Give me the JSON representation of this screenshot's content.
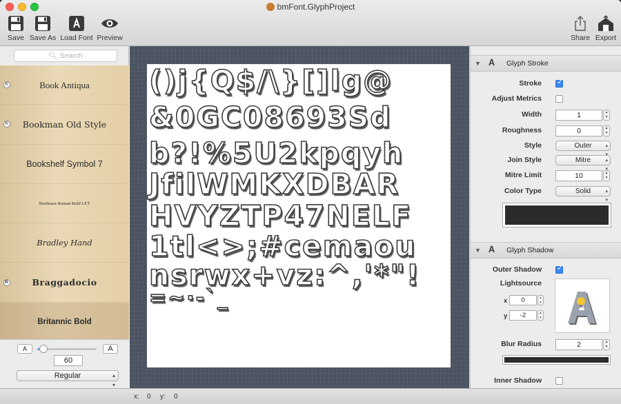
{
  "window": {
    "title": "bmFont.GlyphProject"
  },
  "toolbar": {
    "save": "Save",
    "save_as": "Save As",
    "load_font": "Load Font",
    "preview": "Preview",
    "share": "Share",
    "export": "Export"
  },
  "sidebar": {
    "search_placeholder": "Search",
    "fonts": [
      {
        "name": "Book Antiqua",
        "badge": "K"
      },
      {
        "name": "Bookman Old Style",
        "badge": "K"
      },
      {
        "name": "Bookshelf Symbol 7",
        "badge": ""
      },
      {
        "name": "Bordeaux Roman Bold LET",
        "badge": ""
      },
      {
        "name": "Bradley Hand",
        "badge": ""
      },
      {
        "name": "Braggadocio",
        "badge": "K"
      },
      {
        "name": "Britannic Bold",
        "badge": ""
      }
    ],
    "selected_font": "Britannic Bold",
    "size_small_label": "A",
    "size_large_label": "A",
    "size_value": "60",
    "size_slider_fraction": 0.1,
    "style": "Regular"
  },
  "canvas": {
    "glyph_rows": [
      "()j{Q$/\\}[]lg@",
      "&0GC08693Sd",
      "b?!%5U2kpqyh",
      "JfilWMKXDBAR",
      "HVYZTP47NELF",
      "1tl<>;#cemaou",
      "nsrwx+vz:^,'*\"!",
      "=~·-`_"
    ]
  },
  "inspector": {
    "stroke_section": {
      "title": "Glyph Stroke",
      "stroke_label": "Stroke",
      "stroke_checked": true,
      "adjust_metrics_label": "Adjust Metrics",
      "adjust_metrics_checked": false,
      "width_label": "Width",
      "width_value": "1",
      "roughness_label": "Roughness",
      "roughness_value": "0",
      "style_label": "Style",
      "style_value": "Outer",
      "join_style_label": "Join Style",
      "join_style_value": "Mitre",
      "mitre_limit_label": "Mitre Limit",
      "mitre_limit_value": "10",
      "color_type_label": "Color Type",
      "color_type_value": "Solid",
      "stroke_color": "#2b2b2b"
    },
    "shadow_section": {
      "title": "Glyph Shadow",
      "outer_shadow_label": "Outer Shadow",
      "outer_shadow_checked": true,
      "lightsource_label": "Lightsource",
      "x_label": "x",
      "x_value": "0",
      "y_label": "y",
      "y_value": "-2",
      "blur_radius_label": "Blur Radius",
      "blur_radius_value": "2",
      "shadow_color": "#2b2b2b",
      "inner_shadow_label": "Inner Shadow",
      "inner_shadow_checked": false
    }
  },
  "statusbar": {
    "x_label": "x:",
    "x_value": "0",
    "y_label": "y:",
    "y_value": "0"
  }
}
